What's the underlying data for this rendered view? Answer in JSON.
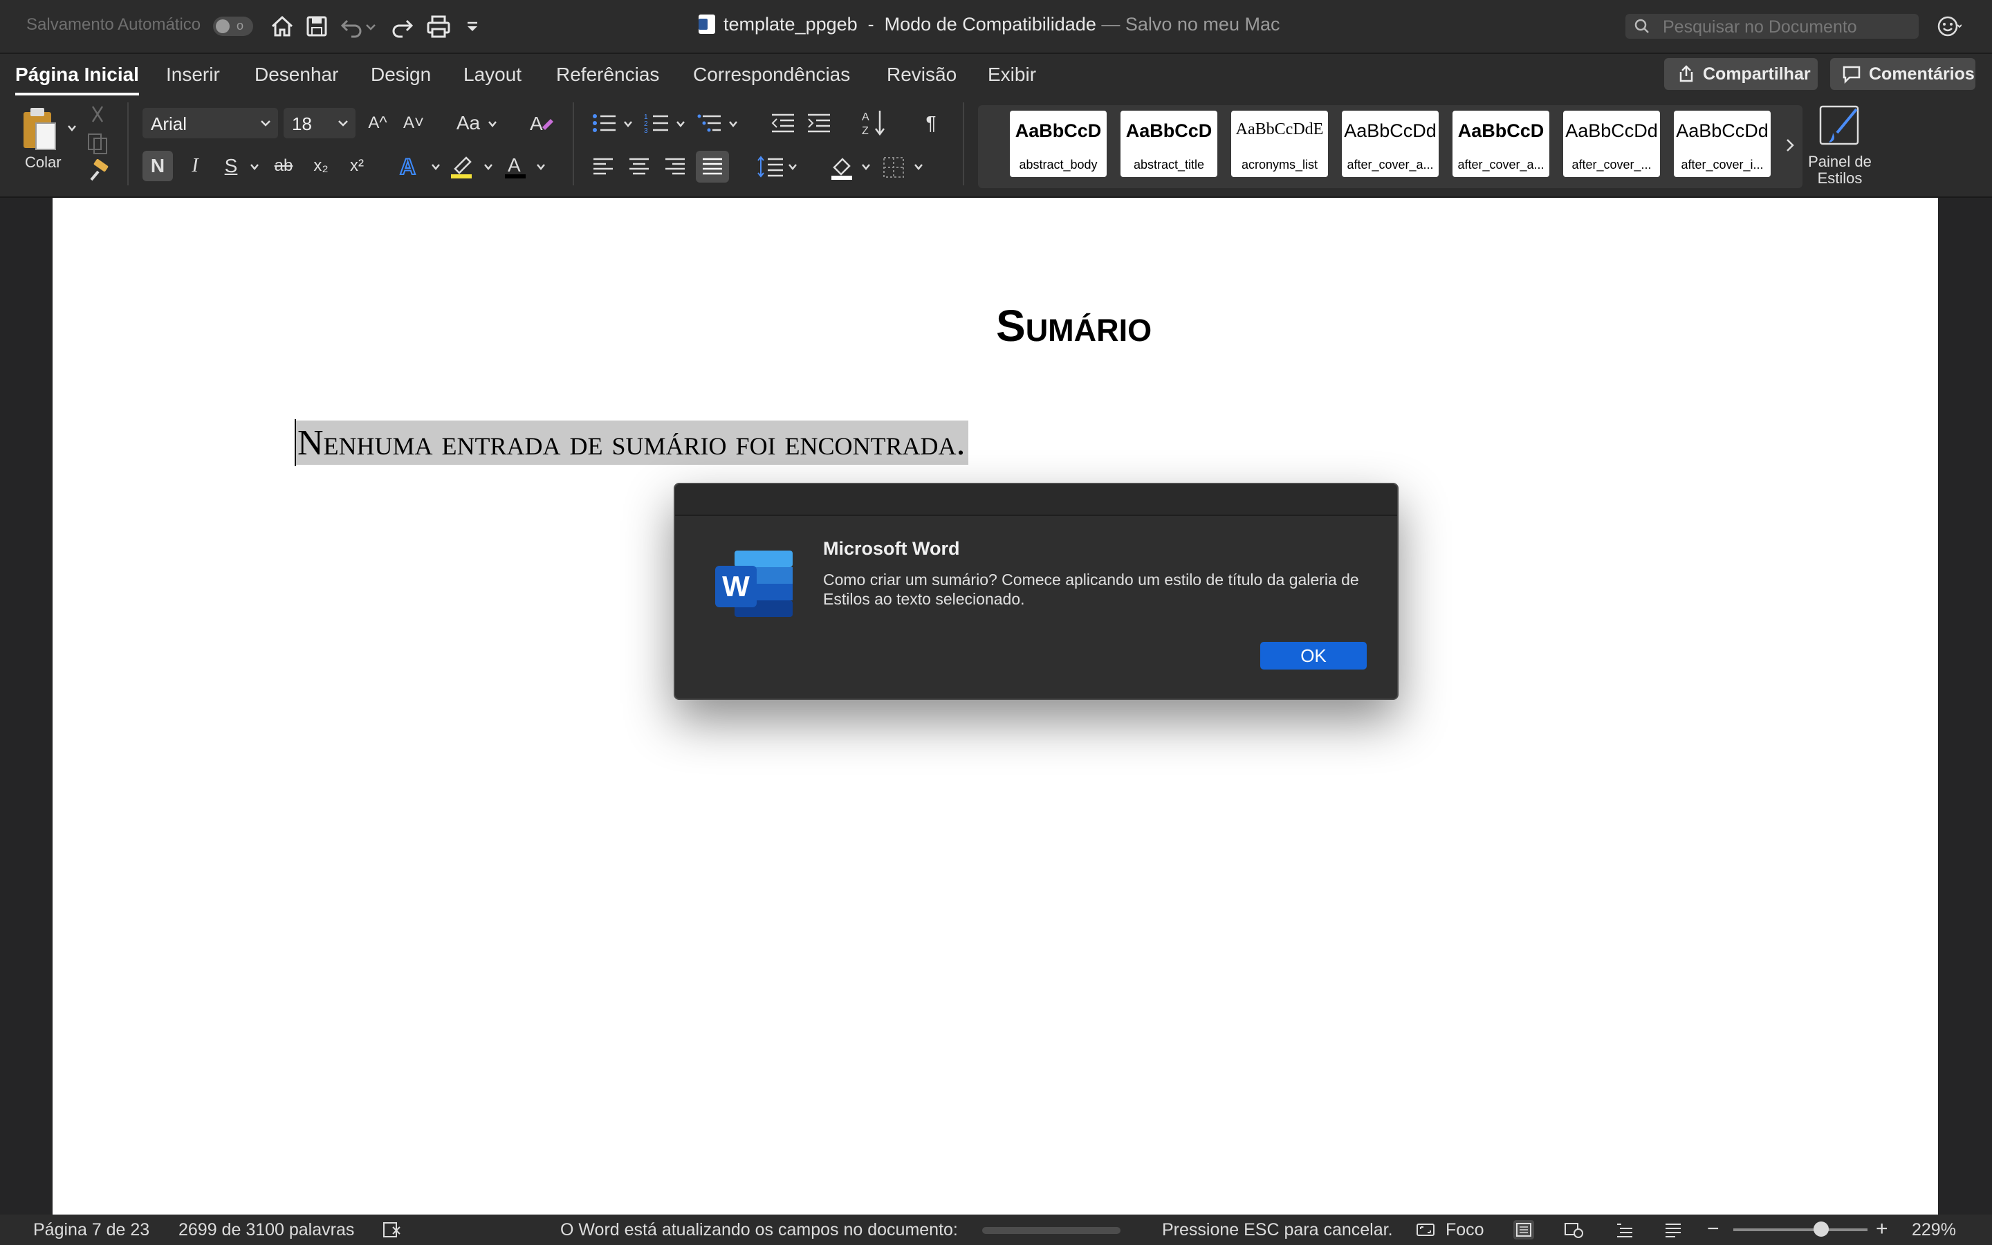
{
  "titlebar": {
    "autosave_label": "Salvamento Automático",
    "autosave_state": "o",
    "doc_name": "template_ppgeb",
    "separator": "  -  ",
    "mode": "Modo de Compatibilidade",
    "saved_status": " — Salvo no meu Mac",
    "search_placeholder": "Pesquisar no Documento"
  },
  "tabs": [
    "Página Inicial",
    "Inserir",
    "Desenhar",
    "Design",
    "Layout",
    "Referências",
    "Correspondências",
    "Revisão",
    "Exibir"
  ],
  "share_label": "Compartilhar",
  "comments_label": "Comentários",
  "ribbon": {
    "paste_label": "Colar",
    "font_name": "Arial",
    "font_size": "18",
    "grow_font": "A^",
    "shrink_font": "A˅",
    "change_case": "Aa",
    "bold": "N",
    "italic": "I",
    "underline": "S",
    "strike": "ab",
    "subscript": "x₂",
    "superscript": "x²",
    "styles_pane_label": "Painel de Estilos",
    "styles": [
      {
        "sample": "AaBbCcD",
        "name": "abstract_body"
      },
      {
        "sample": "AaBbCcD",
        "name": "abstract_title"
      },
      {
        "sample": "AaBbCcDdE",
        "name": "acronyms_list"
      },
      {
        "sample": "AaBbCcDd",
        "name": "after_cover_a..."
      },
      {
        "sample": "AaBbCcD",
        "name": "after_cover_a..."
      },
      {
        "sample": "AaBbCcDd",
        "name": "after_cover_..."
      },
      {
        "sample": "AaBbCcDd",
        "name": "after_cover_i..."
      }
    ]
  },
  "document": {
    "heading": "Sumário",
    "toc_text": "Nenhuma entrada de sumário foi encontrada."
  },
  "dialog": {
    "title": "Microsoft Word",
    "message": "Como criar um sumário? Comece aplicando um estilo de título da galeria de Estilos ao texto selecionado.",
    "ok_label": "OK"
  },
  "status": {
    "page": "Página 7 de 23",
    "words": "2699 de 3100 palavras",
    "updating": "O Word está atualizando os campos no documento:",
    "cancel_hint": "Pressione ESC para cancelar.",
    "focus_label": "Foco",
    "zoom": "229%"
  },
  "colors": {
    "accent": "#1464d9",
    "word_blue": "#2b579a",
    "chrome": "#2c2c2c"
  }
}
